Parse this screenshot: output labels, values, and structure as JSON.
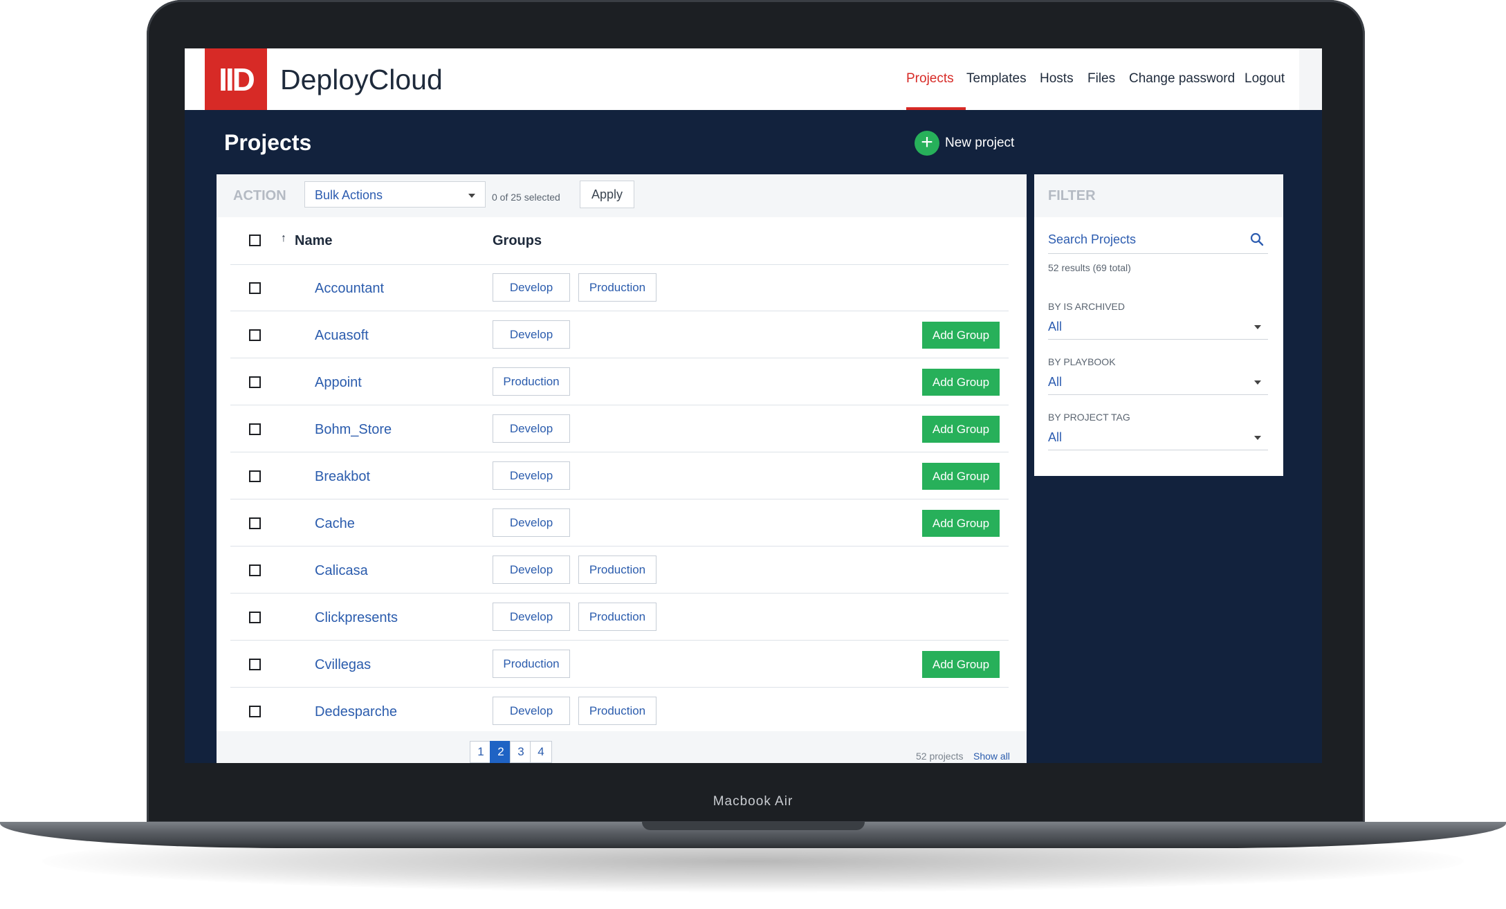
{
  "device": {
    "label": "Macbook Air"
  },
  "app": {
    "logo_text": "IID",
    "brand": "DeployCloud"
  },
  "nav": [
    {
      "label": "Projects",
      "active": true
    },
    {
      "label": "Templates"
    },
    {
      "label": "Hosts"
    },
    {
      "label": "Files"
    },
    {
      "label": "Change password"
    },
    {
      "label": "Logout"
    }
  ],
  "page": {
    "title": "Projects",
    "new_project_label": "New project"
  },
  "toolbar": {
    "action_label": "ACTION",
    "bulk_select": "Bulk Actions",
    "selected_text": "0 of 25 selected",
    "apply_label": "Apply"
  },
  "table": {
    "columns": {
      "name": "Name",
      "groups": "Groups"
    },
    "sort_indicator": "↑",
    "add_group_label": "Add Group",
    "rows": [
      {
        "name": "Accountant",
        "groups": [
          "Develop",
          "Production"
        ],
        "show_add_group": false
      },
      {
        "name": "Acuasoft",
        "groups": [
          "Develop"
        ],
        "show_add_group": true
      },
      {
        "name": "Appoint",
        "groups": [
          "Production"
        ],
        "show_add_group": true
      },
      {
        "name": "Bohm_Store",
        "groups": [
          "Develop"
        ],
        "show_add_group": true
      },
      {
        "name": "Breakbot",
        "groups": [
          "Develop"
        ],
        "show_add_group": true
      },
      {
        "name": "Cache",
        "groups": [
          "Develop"
        ],
        "show_add_group": true
      },
      {
        "name": "Calicasa",
        "groups": [
          "Develop",
          "Production"
        ],
        "show_add_group": false
      },
      {
        "name": "Clickpresents",
        "groups": [
          "Develop",
          "Production"
        ],
        "show_add_group": false
      },
      {
        "name": "Cvillegas",
        "groups": [
          "Production"
        ],
        "show_add_group": true
      },
      {
        "name": "Dedesparche",
        "groups": [
          "Develop",
          "Production"
        ],
        "show_add_group": false
      }
    ]
  },
  "pagination": {
    "pages": [
      "1",
      "2",
      "3",
      "4"
    ],
    "current": 2,
    "count_text": "52 projects",
    "show_all_label": "Show all"
  },
  "filter": {
    "title": "FILTER",
    "search_placeholder": "Search Projects",
    "results_text": "52 results (69 total)",
    "groups": [
      {
        "label": "BY IS ARCHIVED",
        "value": "All"
      },
      {
        "label": "BY PLAYBOOK",
        "value": "All"
      },
      {
        "label": "BY PROJECT TAG",
        "value": "All"
      }
    ]
  },
  "colors": {
    "brand_red": "#d72a26",
    "navy": "#12223d",
    "green": "#27b05a",
    "link_blue": "#2b5cad",
    "page_active": "#1f63c4"
  }
}
